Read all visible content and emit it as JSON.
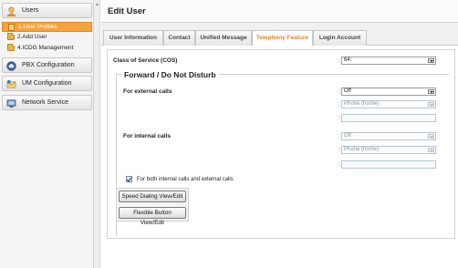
{
  "sidebar": {
    "users": "Users",
    "items": [
      {
        "label": "1.User Profiles"
      },
      {
        "label": "2.Add User"
      },
      {
        "label": "4.ICDG Management"
      }
    ],
    "pbx": "PBX Configuration",
    "um": "UM Configuration",
    "network": "Network Service"
  },
  "main": {
    "title": "Edit User",
    "tabs": [
      "User Information",
      "Contact",
      "Unified Message",
      "Telephony Feature",
      "Login Account"
    ],
    "active_tab": "Telephony Feature"
  },
  "form": {
    "cos_label": "Class of Service (COS)",
    "cos_value": "64:",
    "legend": "Forward / Do Not Disturb",
    "external_label": "For external calls",
    "external_value": "Off",
    "external_dest": "Phone (home)",
    "internal_label": "For internal calls",
    "internal_value": "Off",
    "internal_dest": "Phone (home)",
    "both_label": "For both internal calls and external calls",
    "both_checked": true,
    "speed_dial_button": "Speed Dialing View/Edit",
    "flexible_button": "Flexible Button View/Edit",
    "colon": ":"
  },
  "colors": {
    "accent": "#e8821f",
    "active_nav": "#f5a33c"
  }
}
